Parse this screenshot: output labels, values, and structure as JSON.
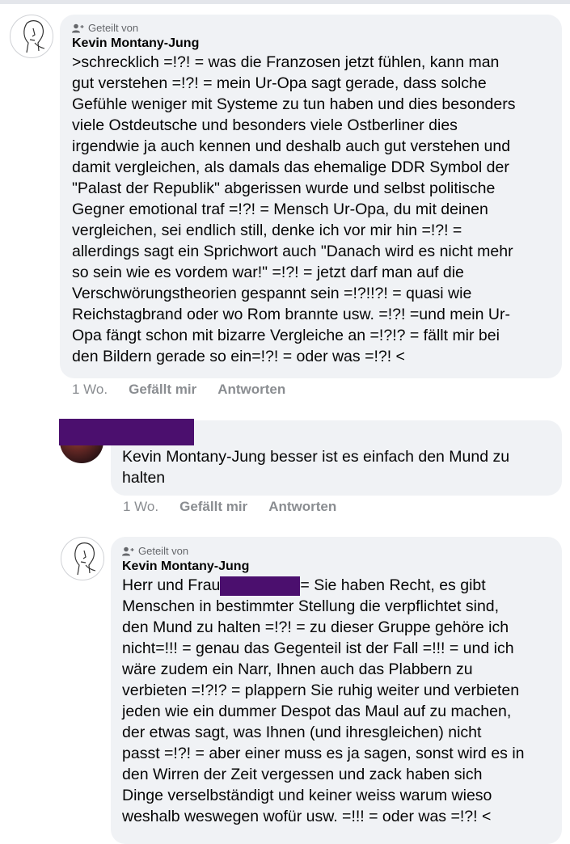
{
  "comments": [
    {
      "shared_label": "Geteilt von",
      "author": "Kevin Montany-Jung",
      "text_lines": [
        ">schrecklich =!?! = was die Franzosen jetzt fühlen, kann man",
        "gut verstehen =!?! = mein Ur-Opa sagt gerade, dass solche",
        "Gefühle weniger mit Systeme zu tun haben und dies besonders",
        "viele Ostdeutsche und besonders viele Ostberliner dies",
        "irgendwie ja auch kennen und deshalb auch gut verstehen und",
        "damit vergleichen, als damals das ehemalige DDR Symbol der",
        "\"Palast der Republik\" abgerissen wurde und selbst politische",
        "Gegner emotional traf =!?! = Mensch Ur-Opa, du mit deinen",
        "vergleichen, sei endlich still, denke ich vor mir hin =!?! =",
        "allerdings sagt ein Sprichwort auch \"Danach wird es nicht mehr",
        "so sein wie es vordem war!\" =!?! = jetzt darf man auf die",
        "Verschwörungstheorien gespannt sein =!?!!?! = quasi wie",
        "Reichstagbrand oder wo Rom brannte usw. =!?! =und mein Ur-",
        "Opa fängt schon mit  bizarre Vergleiche an =!?!? = fällt mir bei",
        "den Bildern gerade so ein=!?! = oder was =!?! <"
      ],
      "time": "1 Wo.",
      "like": "Gefällt mir",
      "reply": "Antworten"
    },
    {
      "text": "Kevin Montany-Jung  besser ist es einfach den Mund zu\nhalten",
      "time": "1 Wo.",
      "like": "Gefällt mir",
      "reply": "Antworten"
    },
    {
      "shared_label": "Geteilt von",
      "author": "Kevin Montany-Jung",
      "first_line_prefix": "Herr und Frau",
      "first_line_suffix": "= Sie haben Recht, es gibt",
      "text": "Menschen in bestimmter Stellung die verpflichtet sind,\nden Mund zu halten =!?! = zu dieser Gruppe gehöre ich\nnicht=!!! = genau das Gegenteil ist der Fall =!!! = und ich\nwäre zudem ein Narr,  Ihnen auch das Plabbern  zu\nverbieten =!?!? = plappern Sie ruhig weiter und verbieten\njeden wie ein dummer Despot  das Maul auf zu machen,\nder etwas sagt, was Ihnen (und ihresgleichen) nicht\npasst =!?! = aber einer muss es ja sagen, sonst wird es in\nden Wirren der Zeit  vergessen und zack haben sich\nDinge verselbständigt und keiner weiss warum wieso\nweshalb weswegen wofür  usw. =!!! = oder was =!?! <"
    }
  ],
  "colors": {
    "bubble": "#f0f2f5",
    "redaction": "#4b0f6e",
    "meta_text": "#65676b"
  }
}
